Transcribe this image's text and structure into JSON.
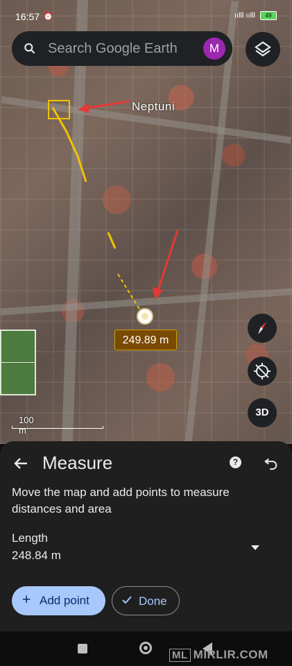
{
  "status_bar": {
    "time": "16:57",
    "alarm_icon": "alarm-icon",
    "signal_text": "ıılll ıılll",
    "battery": "49"
  },
  "search": {
    "placeholder": "Search Google Earth",
    "avatar_letter": "M",
    "avatar_color": "#9c27b0"
  },
  "map": {
    "annotation_label": "Neptuni",
    "annotation_arrow_color": "#e53935",
    "measure_path_color": "#f2c200",
    "current_distance": "249.89 m",
    "scale_label": "100 m",
    "compass_icon": "compass-icon",
    "location_off_icon": "location-disabled-icon",
    "view_3d_label": "3D"
  },
  "sheet": {
    "title": "Measure",
    "instructions": "Move the map and add points to measure distances and area",
    "length_label": "Length",
    "length_value": "248.84 m",
    "add_point_label": "Add point",
    "done_label": "Done",
    "accent_color": "#a8c7fa"
  },
  "watermark": {
    "box_text": "ML",
    "text": "MIRLIR.COM"
  }
}
